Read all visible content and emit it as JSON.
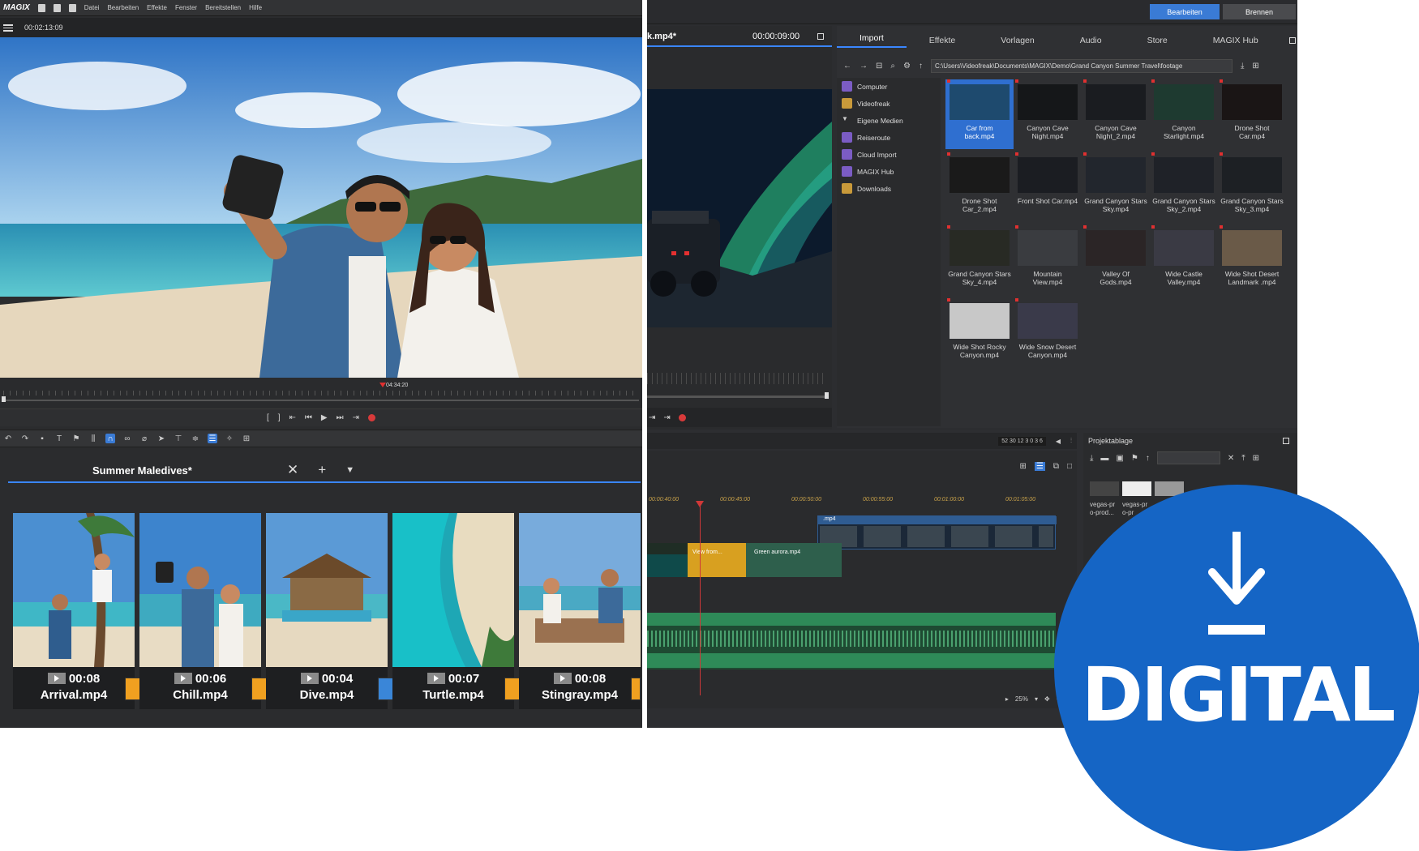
{
  "left_app": {
    "logo": "MAGIX",
    "menu": [
      "Datei",
      "Bearbeiten",
      "Effekte",
      "Fenster",
      "Bereitstellen",
      "Hilfe"
    ],
    "timecode": "00:02:13:09",
    "scrub_marker": "04:34:20",
    "transport": [
      "[",
      "]",
      "⇤",
      "⏮",
      "▶",
      "⏭",
      "⇥"
    ],
    "project_tab": "Summer Malediveѕ*",
    "clips": [
      {
        "duration": "00:08",
        "name": "Arrival.mp4"
      },
      {
        "duration": "00:06",
        "name": "Chill.mp4"
      },
      {
        "duration": "00:04",
        "name": "Dive.mp4"
      },
      {
        "duration": "00:07",
        "name": "Turtle.mp4"
      },
      {
        "duration": "00:08",
        "name": "Stingray.mp4"
      }
    ]
  },
  "right_app": {
    "top_buttons": {
      "edit": "Bearbeiten",
      "burn": "Brennen"
    },
    "file_title": "k.mp4*",
    "file_time": "00:00:09:00",
    "tabs": [
      "Import",
      "Effekte",
      "Vorlagen",
      "Audio",
      "Store",
      "MAGIX Hub"
    ],
    "active_tab": "Import",
    "path": "C:\\Users\\Videofreak\\Documents\\MAGIX\\Demo\\Grand Canyon Summer Travel\\footage",
    "tree": [
      {
        "label": "Computer",
        "color": "#7b5cc4"
      },
      {
        "label": "Videofreak",
        "color": "#c99a3a"
      },
      {
        "label": "Eigene Medien",
        "color": "#2c2d30"
      },
      {
        "label": "Reiseroute",
        "color": "#7b5cc4"
      },
      {
        "label": "Cloud Import",
        "color": "#7b5cc4"
      },
      {
        "label": "MAGIX Hub",
        "color": "#7b5cc4"
      },
      {
        "label": "Downloads",
        "color": "#c99a3a"
      }
    ],
    "media": [
      {
        "line1": "Car from",
        "line2": "back.mp4",
        "selected": true
      },
      {
        "line1": "Canyon Cave",
        "line2": "Night.mp4"
      },
      {
        "line1": "Canyon Cave",
        "line2": "Night_2.mp4"
      },
      {
        "line1": "Canyon",
        "line2": "Starlight.mp4"
      },
      {
        "line1": "Drone Shot",
        "line2": "Car.mp4"
      },
      {
        "line1": "Drone Shot",
        "line2": "Car_2.mp4"
      },
      {
        "line1": "Front Shot Car.mp4",
        "line2": ""
      },
      {
        "line1": "Grand Canyon Stars",
        "line2": "Sky.mp4"
      },
      {
        "line1": "Grand Canyon Stars",
        "line2": "Sky_2.mp4"
      },
      {
        "line1": "Grand Canyon Stars",
        "line2": "Sky_3.mp4"
      },
      {
        "line1": "Grand Canyon Stars",
        "line2": "Sky_4.mp4"
      },
      {
        "line1": "Mountain",
        "line2": "View.mp4"
      },
      {
        "line1": "Valley Of",
        "line2": "Gods.mp4"
      },
      {
        "line1": "Wide Castle",
        "line2": "Valley.mp4"
      },
      {
        "line1": "Wide Shot Desert",
        "line2": "Landmark .mp4"
      },
      {
        "line1": "Wide Shot Rocky",
        "line2": "Canyon.mp4"
      },
      {
        "line1": "Wide Snow Desert",
        "line2": "Canyon.mp4"
      }
    ],
    "ruler": [
      "00:00:40:00",
      "00:00:45:00",
      "00:00:50:00",
      "00:00:55:00",
      "00:01:00:00",
      "00:01:05:00"
    ],
    "track1_label": ".mp4",
    "track2_labels": [
      "View from...",
      "Green aurora.mp4"
    ],
    "zoom": "25%",
    "level_meter": "52 30 12  3 0 3 6",
    "project_panel": {
      "title": "Projektablage",
      "items": [
        "vegas-pr\no-prod...",
        "vegas-pr\no-pr"
      ]
    }
  },
  "badge": {
    "text": "DIGITAL",
    "color": "#1565c5"
  }
}
